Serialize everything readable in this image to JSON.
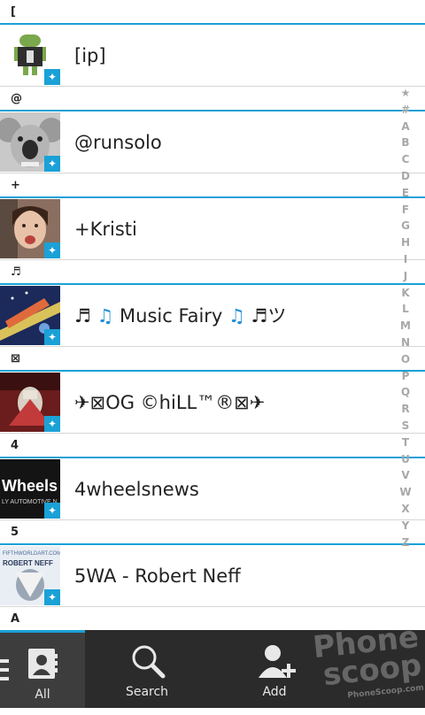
{
  "contacts": {
    "sections": [
      {
        "header": "[",
        "name_parts": [
          {
            "text": "[ip]"
          }
        ]
      },
      {
        "header": "@",
        "name_parts": [
          {
            "text": "@runsolo"
          }
        ]
      },
      {
        "header": "+",
        "name_parts": [
          {
            "text": "+Kristi"
          }
        ]
      },
      {
        "header": "♬",
        "name_parts": [
          {
            "text": "♬ "
          },
          {
            "text": "♫",
            "accent": true
          },
          {
            "text": " Music Fairy "
          },
          {
            "text": "♫",
            "accent": true
          },
          {
            "text": " ♬ツ"
          }
        ]
      },
      {
        "header": "⊠",
        "name_parts": [
          {
            "text": "✈⊠OG ©hiLL™®⊠✈"
          }
        ]
      },
      {
        "header": "4",
        "name_parts": [
          {
            "text": "4wheelsnews"
          }
        ]
      },
      {
        "header": "5",
        "name_parts": [
          {
            "text": "5WA - Robert Neff"
          }
        ]
      },
      {
        "header": "A",
        "name_parts": []
      }
    ],
    "badge_icon": "twitter-bird-icon"
  },
  "alpha_index": [
    "★",
    "#",
    "A",
    "B",
    "C",
    "D",
    "E",
    "F",
    "G",
    "H",
    "I",
    "J",
    "K",
    "L",
    "M",
    "N",
    "O",
    "P",
    "Q",
    "R",
    "S",
    "T",
    "U",
    "V",
    "W",
    "X",
    "Y",
    "Z"
  ],
  "tabbar": {
    "tabs": [
      {
        "label": "All",
        "icon": "contacts-book-icon",
        "active": true
      },
      {
        "label": "Search",
        "icon": "magnifier-icon",
        "active": false
      },
      {
        "label": "Add",
        "icon": "add-person-icon",
        "active": false
      }
    ],
    "overflow_icon": "menu-icon"
  },
  "watermark": {
    "line1": "Phone",
    "line2": "scoop",
    "url": "PhoneScoop.com"
  },
  "colors": {
    "accent": "#1aa1d6",
    "tabbar": "#2b2b2b",
    "text": "#222222",
    "index": "#a8a8a8"
  }
}
